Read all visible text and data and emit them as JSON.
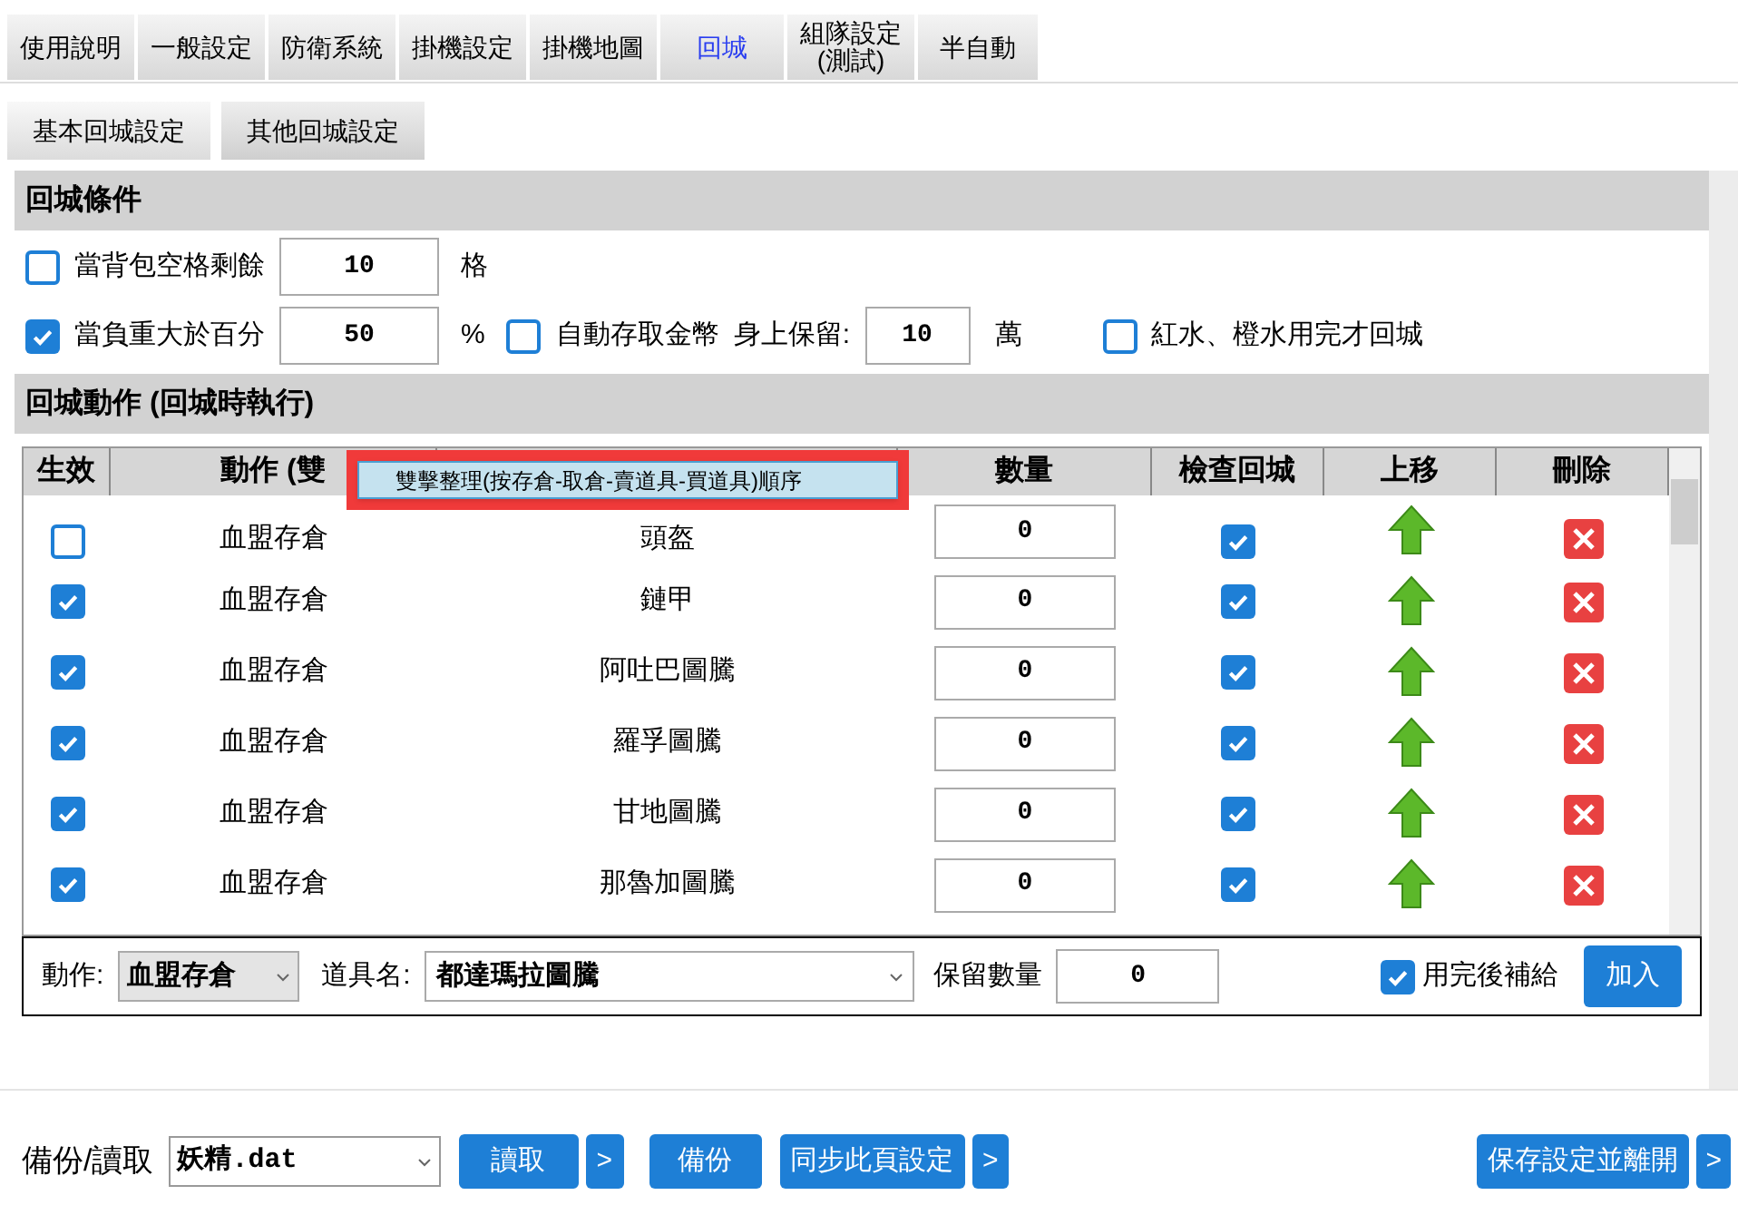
{
  "tabs": [
    {
      "label": "使用說明",
      "selected": false
    },
    {
      "label": "一般設定",
      "selected": false
    },
    {
      "label": "防衛系統",
      "selected": false
    },
    {
      "label": "掛機設定",
      "selected": false
    },
    {
      "label": "掛機地圖",
      "selected": false
    },
    {
      "label": "回城",
      "selected": true
    },
    {
      "label": "組隊設定\n(測試)",
      "selected": false
    },
    {
      "label": "半自動",
      "selected": false
    }
  ],
  "subtabs": [
    {
      "label": "基本回城設定",
      "selected": true
    },
    {
      "label": "其他回城設定",
      "selected": false
    }
  ],
  "conditions": {
    "title": "回城條件",
    "bag": {
      "checked": false,
      "label": "當背包空格剩餘",
      "value": "10",
      "unit": "格"
    },
    "weight": {
      "checked": true,
      "label": "當負重大於百分",
      "value": "50",
      "unit": "%"
    },
    "gold": {
      "checked": false,
      "label": "自動存取金幣",
      "keep_label": "身上保留:",
      "value": "10",
      "unit": "萬"
    },
    "potion": {
      "checked": false,
      "label": "紅水、橙水用完才回城"
    }
  },
  "actions": {
    "title": "回城動作 (回城時執行)",
    "columns": [
      "生效",
      "動作 (雙",
      "數量",
      "檢查回城",
      "上移",
      "刪除"
    ],
    "popup": "雙擊整理(按存倉-取倉-賣道具-買道具)順序",
    "rows": [
      {
        "enabled": false,
        "action": "血盟存倉",
        "item": "頭盔",
        "qty": "0",
        "check": true
      },
      {
        "enabled": true,
        "action": "血盟存倉",
        "item": "鏈甲",
        "qty": "0",
        "check": true
      },
      {
        "enabled": true,
        "action": "血盟存倉",
        "item": "阿吐巴圖騰",
        "qty": "0",
        "check": true
      },
      {
        "enabled": true,
        "action": "血盟存倉",
        "item": "羅孚圖騰",
        "qty": "0",
        "check": true
      },
      {
        "enabled": true,
        "action": "血盟存倉",
        "item": "甘地圖騰",
        "qty": "0",
        "check": true
      },
      {
        "enabled": true,
        "action": "血盟存倉",
        "item": "那魯加圖騰",
        "qty": "0",
        "check": true
      }
    ],
    "add": {
      "action_label": "動作:",
      "action": "血盟存倉",
      "item_label": "道具名:",
      "item": "都達瑪拉圖騰",
      "keep_label": "保留數量",
      "keep": "0",
      "refill": {
        "checked": true,
        "label": "用完後補給"
      },
      "button": "加入"
    }
  },
  "footer": {
    "label": "備份/讀取",
    "file": "妖精.dat",
    "load": "讀取",
    "more1": ">",
    "backup": "備份",
    "sync": "同步此頁設定",
    "more2": ">",
    "save": "保存設定並離開",
    "more3": ">"
  }
}
